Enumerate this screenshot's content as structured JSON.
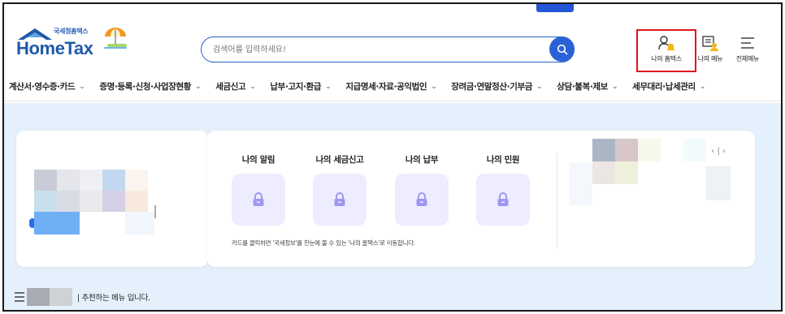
{
  "header": {
    "logo_ko": "국세청홈택스",
    "logo_en": "HomeTax",
    "search_placeholder": "검색어를 입력하세요!",
    "util": {
      "my_hometax": "나의 홈택스",
      "my_menu": "나의 메뉴",
      "all_menu": "전체메뉴"
    }
  },
  "nav": {
    "items": [
      "계산서·영수증·카드",
      "증명·등록·신청·사업장현황",
      "세금신고",
      "납부·고지·환급",
      "지급명세·자료·공익법인",
      "장려금·연말정산·기부금",
      "상담·불복·제보",
      "세무대리·납세관리"
    ]
  },
  "main": {
    "quick": [
      "나의 알림",
      "나의 세금신고",
      "나의 납부",
      "나의 민원"
    ],
    "note": "카드를 클릭하면 '국세정보'를 한눈에 볼 수 있는 '나의 홈택스'로 이동합니다.",
    "carousel": "‹ | ›"
  },
  "recommend_suffix": "| 추천하는 메뉴 입니다.",
  "colors": {
    "brand_blue": "#2a62d6",
    "highlight_red": "#e0141e",
    "content_bg": "#e4f0fb",
    "quick_box": "#eeecff",
    "lock_purple": "#9f98f0"
  },
  "icons": [
    "search-icon",
    "user-bell-icon",
    "menu-person-icon",
    "hamburger-icon",
    "lock-icon",
    "chevron-down-icon"
  ]
}
